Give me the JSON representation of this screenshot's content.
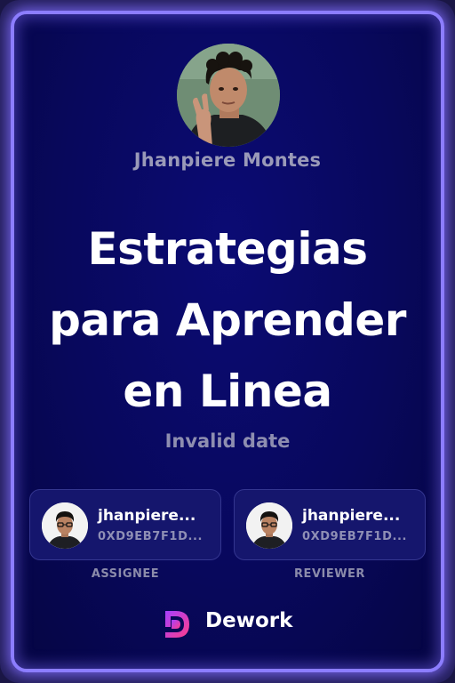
{
  "author": {
    "name": "Jhanpiere Montes"
  },
  "task": {
    "title": "Estrategias para Aprender en Linea",
    "date": "Invalid date"
  },
  "assignee": {
    "name": "jhanpiere...",
    "address": "0XD9EB7F1D...",
    "role_label": "ASSIGNEE"
  },
  "reviewer": {
    "name": "jhanpiere...",
    "address": "0XD9EB7F1D...",
    "role_label": "REVIEWER"
  },
  "brand": {
    "name": "Dework",
    "logo_icon": "dework-logo-icon"
  },
  "colors": {
    "card_background": "#08085c",
    "card_border_glow": "#8c7dff",
    "user_card_background": "#15166d",
    "muted_text": "#9a9ab8",
    "title_text": "#ffffff"
  }
}
